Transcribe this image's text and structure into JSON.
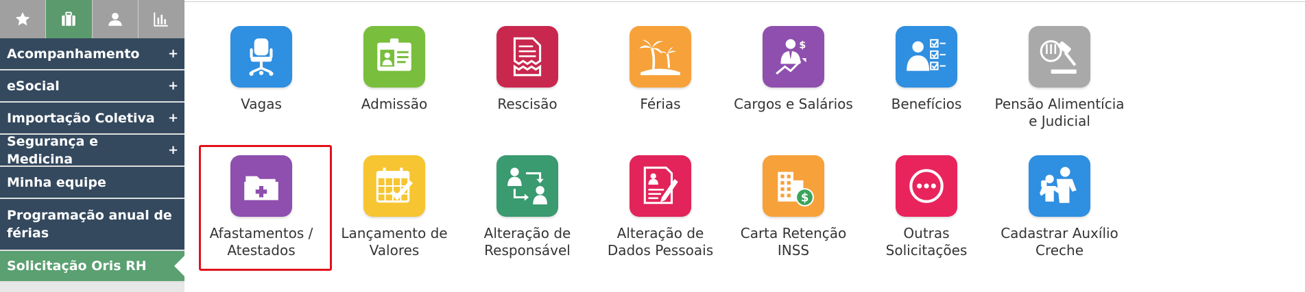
{
  "sidebar": {
    "tabs": [
      {
        "icon": "star-icon",
        "active": false
      },
      {
        "icon": "briefcase-icon",
        "active": true
      },
      {
        "icon": "user-icon",
        "active": false
      },
      {
        "icon": "bar-chart-icon",
        "active": false
      }
    ],
    "items": [
      {
        "label": "Acompanhamento",
        "plus": "+"
      },
      {
        "label": "eSocial",
        "plus": "+"
      },
      {
        "label": "Importação Coletiva",
        "plus": "+"
      },
      {
        "label": "Segurança e Medicina",
        "plus": "+"
      },
      {
        "label": "Minha equipe",
        "plus": ""
      },
      {
        "label": "Programação anual de férias",
        "plus": ""
      },
      {
        "label": "Solicitação Oris RH",
        "plus": ""
      }
    ]
  },
  "grid": {
    "row1": [
      {
        "label": "Vagas",
        "icon": "office-chair-icon",
        "color": "#2f8fe0"
      },
      {
        "label": "Admissão",
        "icon": "id-card-icon",
        "color": "#79be3c"
      },
      {
        "label": "Rescisão",
        "icon": "torn-document-icon",
        "color": "#c8284e"
      },
      {
        "label": "Férias",
        "icon": "palm-tree-icon",
        "color": "#f7a13a"
      },
      {
        "label": "Cargos e Salários",
        "icon": "career-growth-icon",
        "color": "#8e4fae"
      },
      {
        "label": "Benefícios",
        "icon": "checklist-person-icon",
        "color": "#2f8fe0"
      },
      {
        "label": "Pensão Alimentícia e Judicial",
        "icon": "gavel-icon",
        "color": "#a9a9a9"
      }
    ],
    "row2": [
      {
        "label": "Afastamentos / Atestados",
        "icon": "medical-folder-icon",
        "color": "#8e4fae"
      },
      {
        "label": "Lançamento de Valores",
        "icon": "calendar-check-icon",
        "color": "#f6c531"
      },
      {
        "label": "Alteração de Responsável",
        "icon": "swap-people-icon",
        "color": "#3a9a70"
      },
      {
        "label": "Alteração de Dados Pessoais",
        "icon": "edit-document-icon",
        "color": "#e2245a"
      },
      {
        "label": "Carta Retenção INSS",
        "icon": "building-money-icon",
        "color": "#f7a13a"
      },
      {
        "label": "Outras Solicitações",
        "icon": "more-dots-icon",
        "color": "#e9245c"
      },
      {
        "label": "Cadastrar Auxílio Creche",
        "icon": "mother-child-icon",
        "color": "#2f8fe0"
      }
    ]
  }
}
